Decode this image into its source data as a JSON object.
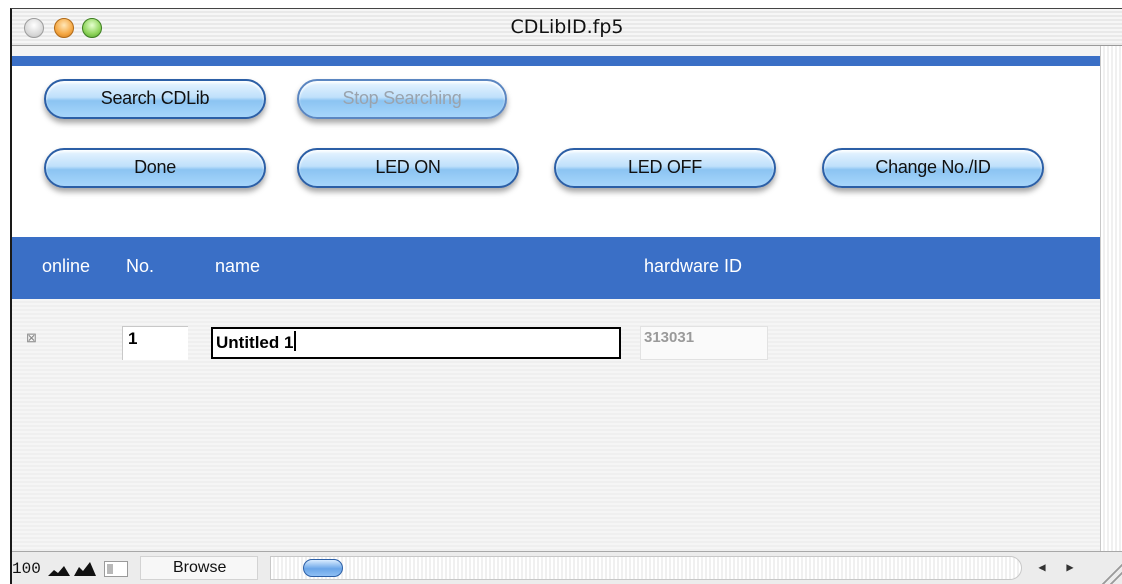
{
  "window": {
    "title": "CDLibID.fp5"
  },
  "toolbar": {
    "search": "Search CDLib",
    "stop": "Stop Searching",
    "done": "Done",
    "led_on": "LED ON",
    "led_off": "LED OFF",
    "change_id": "Change No./ID"
  },
  "columns": {
    "online": "online",
    "no": "No.",
    "name": "name",
    "hardware_id": "hardware ID"
  },
  "record": {
    "online_checked": true,
    "no": "1",
    "name": "Untitled 1",
    "hardware_id": "313031"
  },
  "statusbar": {
    "zoom": "100",
    "mode": "Browse"
  },
  "colors": {
    "accent_blue": "#3a6fc6",
    "button_blue": "#a7d6fb"
  },
  "icons": {
    "online_checkbox": "checkbox-x-icon",
    "zoom_out": "mountain-small-icon",
    "zoom_in": "mountain-large-icon",
    "layout": "status-area-icon"
  }
}
